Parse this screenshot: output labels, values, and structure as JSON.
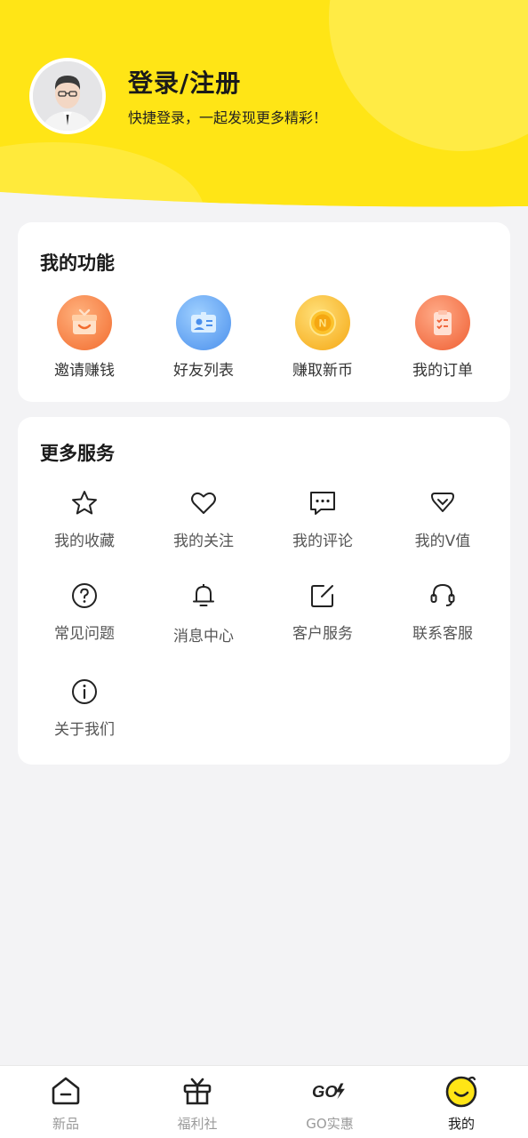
{
  "profile": {
    "title": "登录/注册",
    "subtitle": "快捷登录，一起发现更多精彩！"
  },
  "functions": {
    "title": "我的功能",
    "items": [
      {
        "label": "邀请赚钱",
        "icon": "gift-box-icon",
        "color": "#f37a3a"
      },
      {
        "label": "好友列表",
        "icon": "contact-card-icon",
        "color": "#5aa6f2"
      },
      {
        "label": "赚取新币",
        "icon": "coin-icon",
        "color": "#f7b51d"
      },
      {
        "label": "我的订单",
        "icon": "order-list-icon",
        "color": "#f26c3c"
      }
    ]
  },
  "services": {
    "title": "更多服务",
    "items": [
      {
        "label": "我的收藏",
        "icon": "star-icon"
      },
      {
        "label": "我的关注",
        "icon": "heart-icon"
      },
      {
        "label": "我的评论",
        "icon": "comment-icon"
      },
      {
        "label": "我的V值",
        "icon": "v-value-icon"
      },
      {
        "label": "常见问题",
        "icon": "question-icon"
      },
      {
        "label": "消息中心",
        "icon": "bell-icon"
      },
      {
        "label": "客户服务",
        "icon": "edit-icon"
      },
      {
        "label": "联系客服",
        "icon": "headset-icon"
      },
      {
        "label": "关于我们",
        "icon": "info-icon"
      }
    ]
  },
  "bottom_nav": {
    "items": [
      {
        "label": "新品",
        "icon": "home-icon",
        "active": false
      },
      {
        "label": "福利社",
        "icon": "gift-icon",
        "active": false
      },
      {
        "label": "GO实惠",
        "icon": "go-icon",
        "active": false
      },
      {
        "label": "我的",
        "icon": "smiley-icon",
        "active": true
      }
    ]
  },
  "colors": {
    "brand_yellow": "#ffe516",
    "background": "#f3f3f5"
  }
}
